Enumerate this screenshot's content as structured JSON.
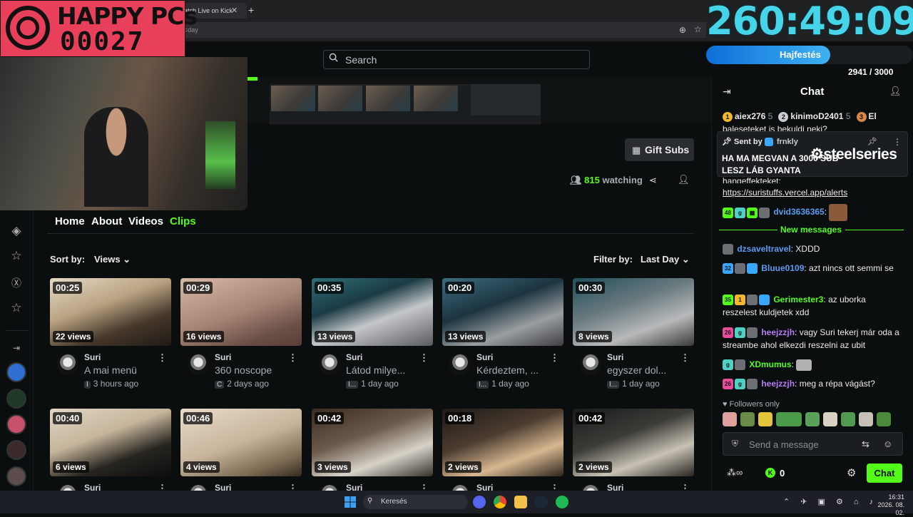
{
  "browser": {
    "tab_title": "atch Live on Kick",
    "url_fragment": "=day"
  },
  "overlay": {
    "brand_title": "HAPPY PCs",
    "brand_number": "00027",
    "timer": "260:49:09",
    "goal_label": "Hajfestés",
    "goal_progress": 0.6,
    "goal_count": "2941 / 3000"
  },
  "header": {
    "search_placeholder": "Search"
  },
  "channel": {
    "gift_subs_label": "Gift Subs",
    "watching_count": "815",
    "watching_label": "watching"
  },
  "nav": {
    "tabs": [
      {
        "label": "Home"
      },
      {
        "label": "About"
      },
      {
        "label": "Videos"
      },
      {
        "label": "Clips"
      }
    ]
  },
  "filters": {
    "sort_label": "Sort by:",
    "sort_value": "Views",
    "filter_label": "Filter by:",
    "filter_value": "Last Day"
  },
  "clips": [
    {
      "duration": "00:25",
      "views": "22 views",
      "channel": "Suri",
      "title": "A mai menü",
      "category": "I",
      "age": "3 hours ago"
    },
    {
      "duration": "00:29",
      "views": "16 views",
      "channel": "Suri",
      "title": "360 noscope",
      "category": "C",
      "age": "2 days ago"
    },
    {
      "duration": "00:35",
      "views": "13 views",
      "channel": "Suri",
      "title": "Látod milye...",
      "category": "I...",
      "age": "1 day ago"
    },
    {
      "duration": "00:20",
      "views": "13 views",
      "channel": "Suri",
      "title": "Kérdeztem, ...",
      "category": "I...",
      "age": "1 day ago"
    },
    {
      "duration": "00:30",
      "views": "8 views",
      "channel": "Suri",
      "title": "egyszer dol...",
      "category": "I...",
      "age": "1 day ago"
    },
    {
      "duration": "00:40",
      "views": "6 views",
      "channel": "Suri"
    },
    {
      "duration": "00:46",
      "views": "4 views",
      "channel": "Suri"
    },
    {
      "duration": "00:42",
      "views": "3 views",
      "channel": "Suri"
    },
    {
      "duration": "00:18",
      "views": "2 views",
      "channel": "Suri"
    },
    {
      "duration": "00:42",
      "views": "2 views",
      "channel": "Suri"
    }
  ],
  "chat": {
    "title": "Chat",
    "gifters": [
      {
        "name": "aiex276",
        "count": "5",
        "color": "#f2b72c"
      },
      {
        "name": "kinimoD2401",
        "count": "5",
        "color": "#c9ccd0"
      },
      {
        "name": "El",
        "count": "",
        "color": "#d8874a"
      }
    ],
    "partial_line": "baleseteket is bekuldi neki?",
    "pinned": {
      "sent_by": "Sent by",
      "user": "frnkly",
      "message": "HA MA MEGVAN A 3000 SUB LESZ LÁB GYANTA",
      "sponsor": "steelseries"
    },
    "partial_line2": "hangeffekteket:",
    "link": "https://suristuffs.vercel.app/alerts",
    "messages_before": [
      {
        "user": "dvid3636365",
        "text": "",
        "color": "#5c9cf0"
      }
    ],
    "new_messages_label": "New messages",
    "messages": [
      {
        "user": "dzsaveltravel",
        "text": "XDDD",
        "color": "#5c9cf0"
      },
      {
        "user": "Bluue0109",
        "text": "azt nincs ott semmi se",
        "color": "#5c9cf0"
      },
      {
        "user": "Gerimester3",
        "text": "az uborka reszelest kuldjetek xdd",
        "color": "#53fc18"
      },
      {
        "user": "heejzzjh",
        "text": "vagy Suri tekerj már oda a streambe ahol elkezdi reszelni az ubit",
        "color": "#b57cf4"
      },
      {
        "user": "XDmumus",
        "text": "",
        "color": "#53fc18"
      },
      {
        "user": "heejzzjh",
        "text": "meg a répa vágást?",
        "color": "#b57cf4"
      }
    ],
    "followers_only": "Followers only",
    "input_placeholder": "Send a message",
    "kicks_count": "0",
    "send_label": "Chat"
  },
  "taskbar": {
    "search_label": "Keresés",
    "time": "16:31",
    "date": "2026. 08. 02."
  },
  "colors": {
    "accent": "#53fc18",
    "timer": "#46d4e8",
    "brand": "#e8405a"
  }
}
